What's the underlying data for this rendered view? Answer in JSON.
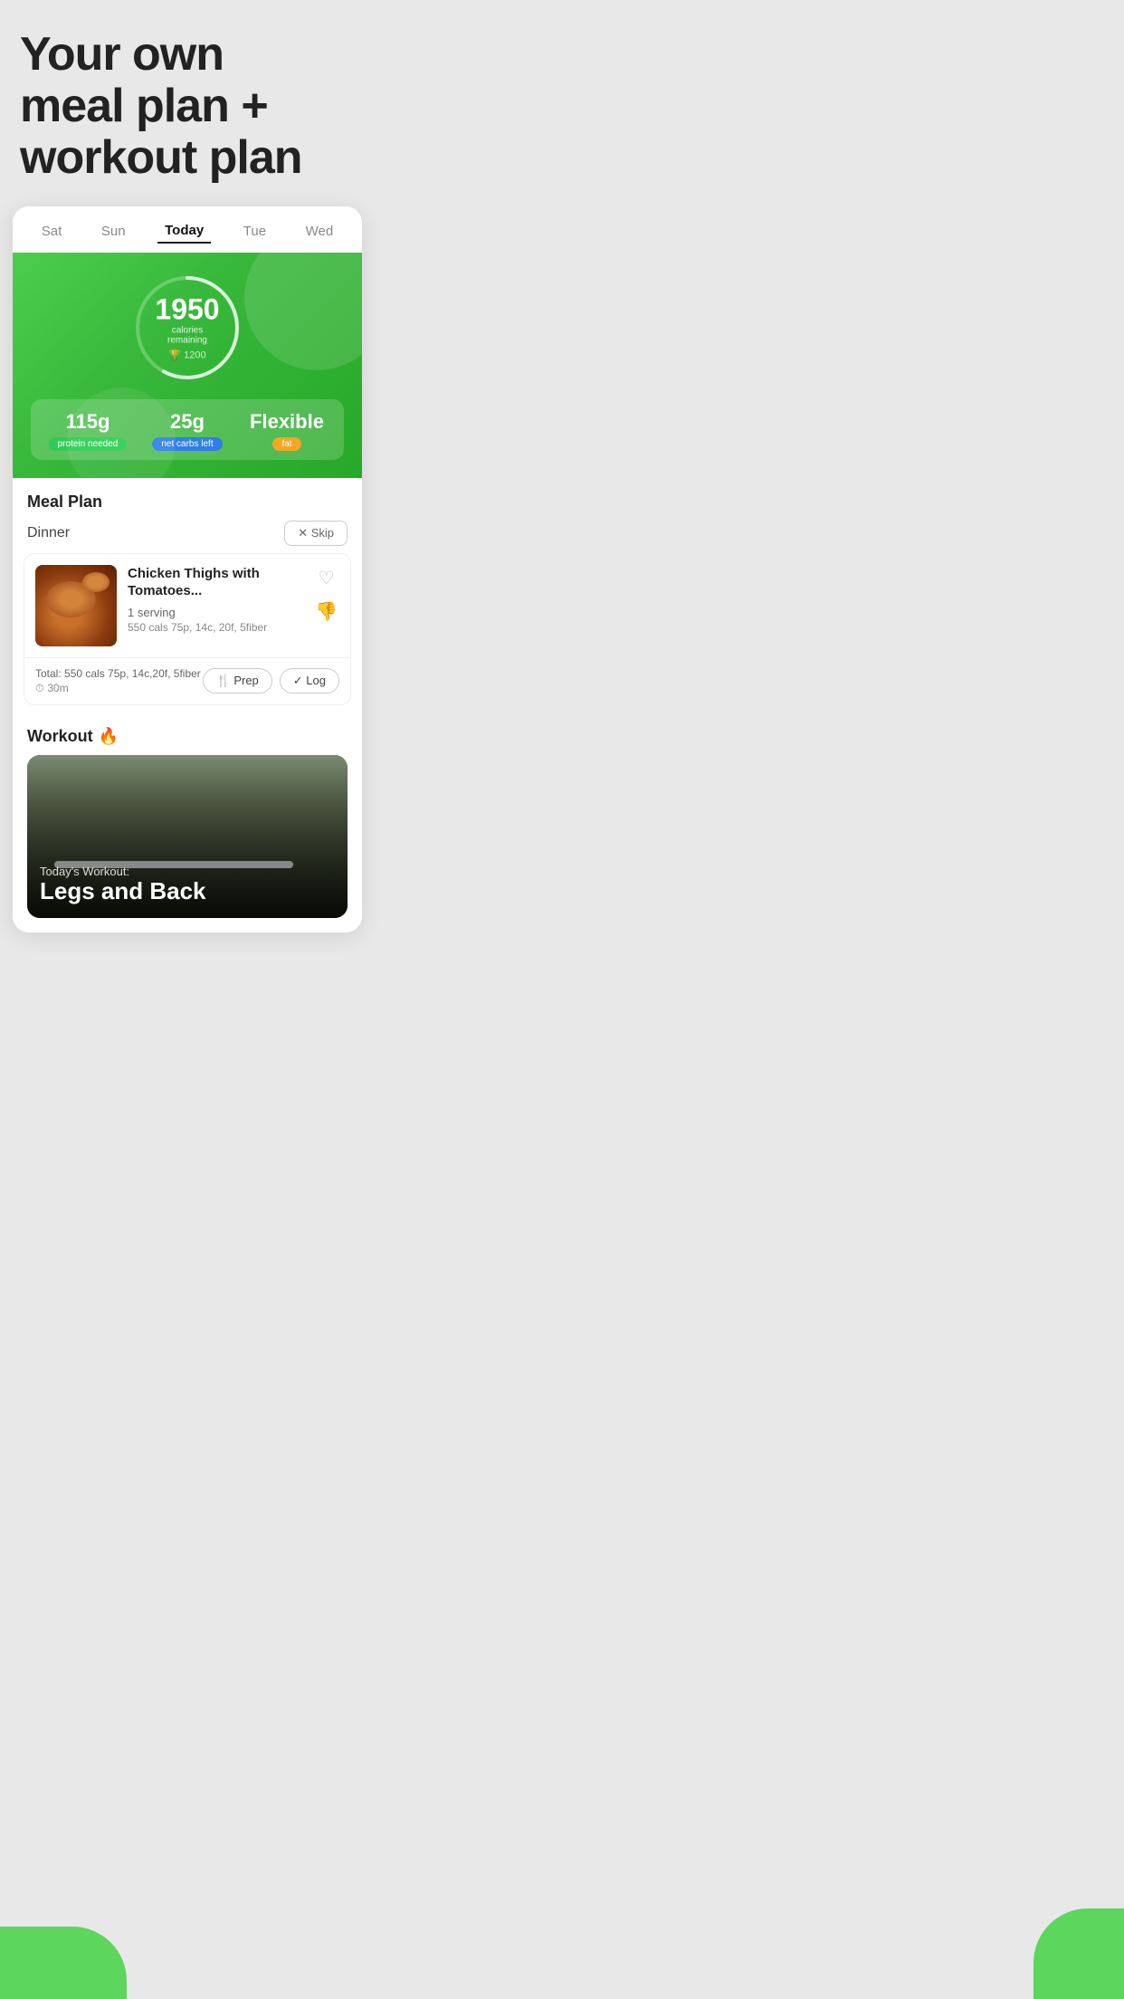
{
  "hero": {
    "title": "Your own\nmeal plan +\nworkout plan"
  },
  "day_tabs": {
    "days": [
      {
        "label": "Sat",
        "active": false
      },
      {
        "label": "Sun",
        "active": false
      },
      {
        "label": "Today",
        "active": true
      },
      {
        "label": "Tue",
        "active": false
      },
      {
        "label": "Wed",
        "active": false
      }
    ]
  },
  "calories": {
    "value": "1950",
    "label": "calories remaining",
    "goal": "🏆 1200"
  },
  "macros": [
    {
      "value": "115g",
      "label": "protein needed",
      "badge_class": "badge-green"
    },
    {
      "value": "25g",
      "label": "net carbs left",
      "badge_class": "badge-blue"
    },
    {
      "value": "Flexible",
      "label": "fat",
      "badge_class": "badge-orange"
    }
  ],
  "meal_plan": {
    "section_title": "Meal Plan",
    "meal_type": "Dinner",
    "skip_label": "✕ Skip",
    "recipe": {
      "title": "Chicken Thighs with Tomatoes...",
      "serving": "1 serving",
      "macros": "550 cals 75p, 14c, 20f, 5fiber",
      "total": "Total: 550 cals 75p, 14c,20f, 5fiber",
      "time": "30m",
      "prep_label": "🍴 Prep",
      "log_label": "✓ Log"
    }
  },
  "workout": {
    "section_title": "Workout",
    "fire_icon": "🔥",
    "subtitle": "Today's Workout:",
    "name": "Legs and Back"
  }
}
